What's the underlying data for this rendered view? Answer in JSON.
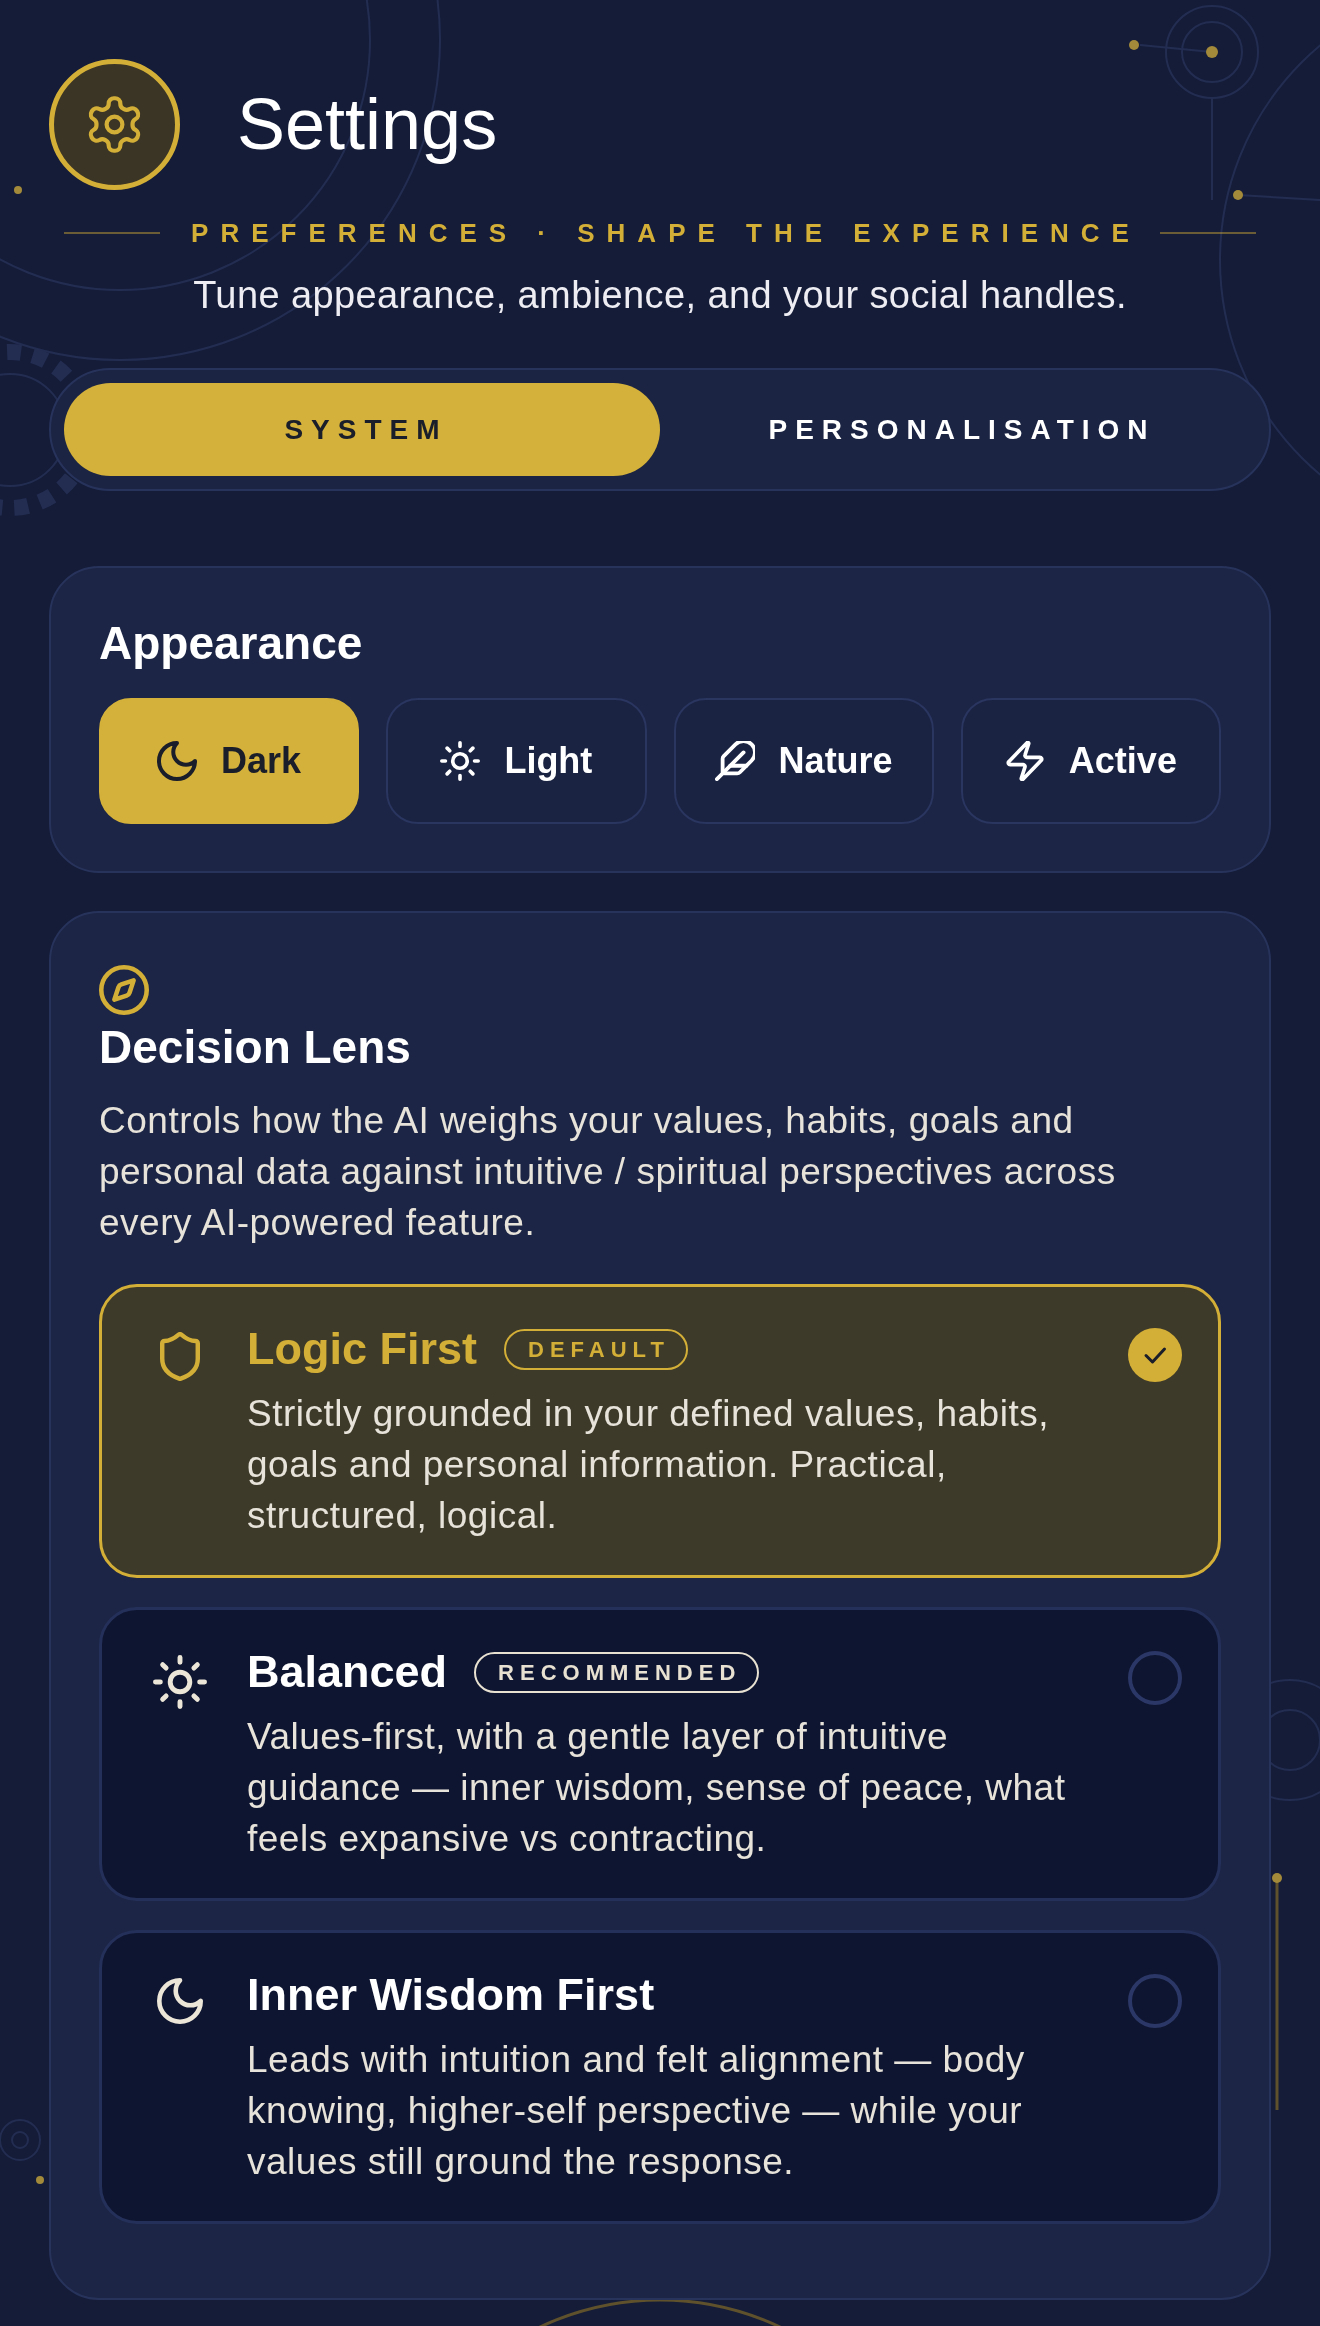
{
  "header": {
    "title": "Settings",
    "eyebrow": "PREFERENCES · SHAPE THE EXPERIENCE",
    "subtitle": "Tune appearance, ambience, and your social handles."
  },
  "tabs": [
    {
      "label": "SYSTEM",
      "selected": true
    },
    {
      "label": "PERSONALISATION",
      "selected": false
    }
  ],
  "appearance": {
    "title": "Appearance",
    "options": [
      {
        "label": "Dark",
        "selected": true
      },
      {
        "label": "Light",
        "selected": false
      },
      {
        "label": "Nature",
        "selected": false
      },
      {
        "label": "Active",
        "selected": false
      }
    ]
  },
  "decision_lens": {
    "title": "Decision Lens",
    "description": "Controls how the AI weighs your values, habits, goals and personal data against intuitive / spiritual perspectives across every AI-powered feature.",
    "options": [
      {
        "title": "Logic First",
        "badge": "DEFAULT",
        "description": "Strictly grounded in your defined values, habits, goals and personal information. Practical, structured, logical.",
        "selected": true
      },
      {
        "title": "Balanced",
        "badge": "RECOMMENDED",
        "description": "Values-first, with a gentle layer of intuitive guidance — inner wisdom, sense of peace, what feels expansive vs contracting.",
        "selected": false
      },
      {
        "title": "Inner Wisdom First",
        "description": "Leads with intuition and felt alignment — body knowing, higher-self perspective — while your values still ground the response.",
        "selected": false
      }
    ]
  }
}
